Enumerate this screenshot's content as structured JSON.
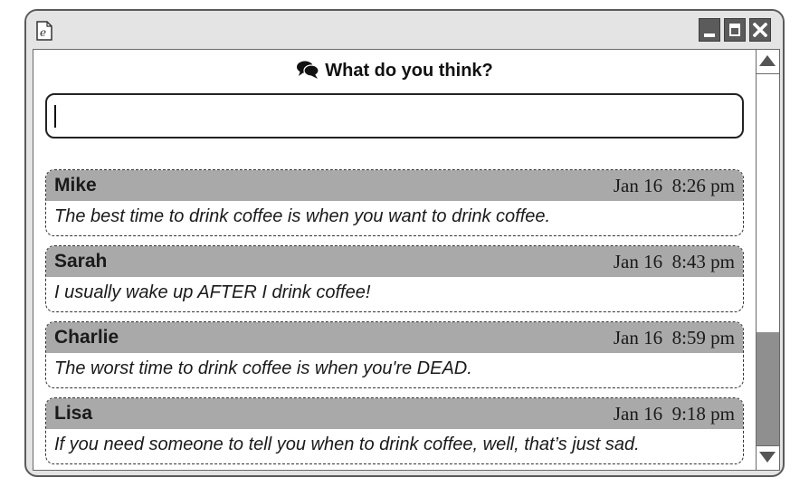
{
  "window": {
    "icon": "document-e-icon",
    "controls": [
      "minimize-icon",
      "maximize-icon",
      "close-icon"
    ]
  },
  "prompt": {
    "icon": "chat-bubbles-icon",
    "text": "What do you think?"
  },
  "comment_input": {
    "value": "",
    "placeholder": ""
  },
  "comments": [
    {
      "author": "Mike",
      "timestamp": "Jan 16  8:26 pm",
      "text": "The best time to drink coffee is when you want to drink coffee."
    },
    {
      "author": "Sarah",
      "timestamp": "Jan 16  8:43 pm",
      "text": "I usually wake up AFTER I drink coffee!"
    },
    {
      "author": "Charlie",
      "timestamp": "Jan 16  8:59 pm",
      "text": "The worst time to drink coffee is when you're DEAD."
    },
    {
      "author": "Lisa",
      "timestamp": "Jan 16  9:18 pm",
      "text": "If you need someone to tell you when to drink coffee, well, that’s just sad."
    }
  ],
  "colors": {
    "comment_header": "#a9a9a9",
    "window_frame": "#e4e4e4",
    "scroll_thumb": "#8f8f8f"
  }
}
